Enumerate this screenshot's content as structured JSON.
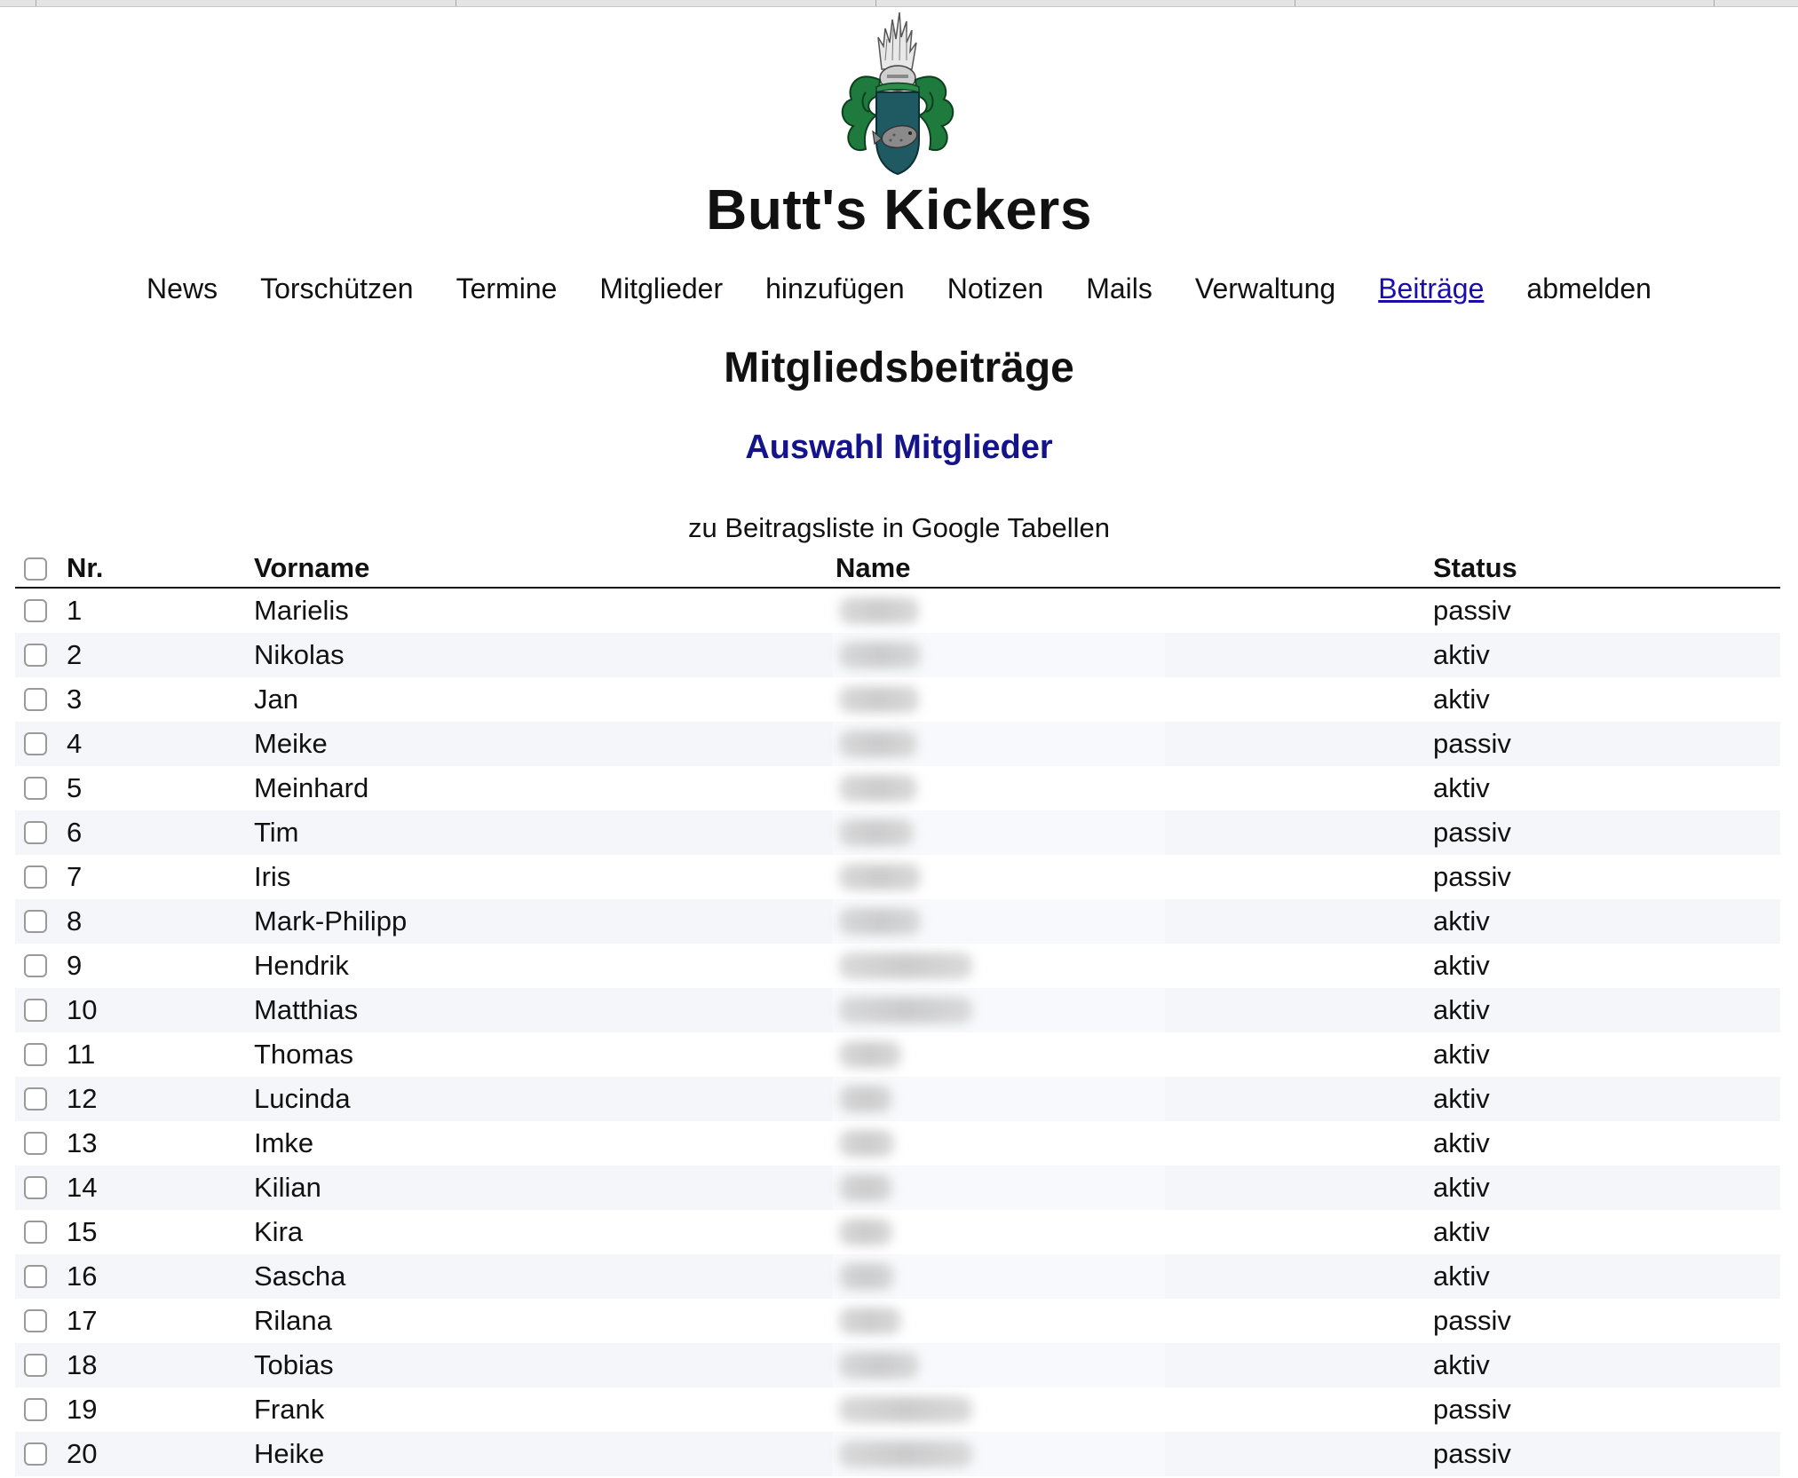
{
  "app": {
    "title": "Butt's Kickers"
  },
  "nav": {
    "items": [
      {
        "label": "News"
      },
      {
        "label": "Torschützen"
      },
      {
        "label": "Termine"
      },
      {
        "label": "Mitglieder"
      },
      {
        "label": "hinzufügen"
      },
      {
        "label": "Notizen"
      },
      {
        "label": "Mails"
      },
      {
        "label": "Verwaltung"
      },
      {
        "label": "Beiträge",
        "active": true
      },
      {
        "label": "abmelden"
      }
    ]
  },
  "page": {
    "title": "Mitgliedsbeiträge",
    "subtitle": "Auswahl Mitglieder",
    "sheet_link": "zu Beitragsliste in Google Tabellen"
  },
  "table": {
    "headers": {
      "nr": "Nr.",
      "vorname": "Vorname",
      "name": "Name",
      "status": "Status"
    },
    "rows": [
      {
        "nr": "1",
        "vorname": "Marielis",
        "status": "passiv"
      },
      {
        "nr": "2",
        "vorname": "Nikolas",
        "status": "aktiv"
      },
      {
        "nr": "3",
        "vorname": "Jan",
        "status": "aktiv"
      },
      {
        "nr": "4",
        "vorname": "Meike",
        "status": "passiv"
      },
      {
        "nr": "5",
        "vorname": "Meinhard",
        "status": "aktiv"
      },
      {
        "nr": "6",
        "vorname": "Tim",
        "status": "passiv"
      },
      {
        "nr": "7",
        "vorname": "Iris",
        "status": "passiv"
      },
      {
        "nr": "8",
        "vorname": "Mark-Philipp",
        "status": "aktiv"
      },
      {
        "nr": "9",
        "vorname": "Hendrik",
        "status": "aktiv"
      },
      {
        "nr": "10",
        "vorname": "Matthias",
        "status": "aktiv"
      },
      {
        "nr": "11",
        "vorname": "Thomas",
        "status": "aktiv"
      },
      {
        "nr": "12",
        "vorname": "Lucinda",
        "status": "aktiv"
      },
      {
        "nr": "13",
        "vorname": "Imke",
        "status": "aktiv"
      },
      {
        "nr": "14",
        "vorname": "Kilian",
        "status": "aktiv"
      },
      {
        "nr": "15",
        "vorname": "Kira",
        "status": "aktiv"
      },
      {
        "nr": "16",
        "vorname": "Sascha",
        "status": "aktiv"
      },
      {
        "nr": "17",
        "vorname": "Rilana",
        "status": "passiv"
      },
      {
        "nr": "18",
        "vorname": "Tobias",
        "status": "aktiv"
      },
      {
        "nr": "19",
        "vorname": "Frank",
        "status": "passiv"
      },
      {
        "nr": "20",
        "vorname": "Heike",
        "status": "passiv"
      }
    ]
  },
  "colors": {
    "active_link": "#1a0dab",
    "subtitle": "#15138a",
    "row_alt": "#f5f6fa",
    "crest_green": "#1f7a3d",
    "crest_shield": "#1f5a63"
  },
  "icons": {
    "logo": "coat-of-arms-crest-icon",
    "checkbox": "checkbox-icon"
  }
}
